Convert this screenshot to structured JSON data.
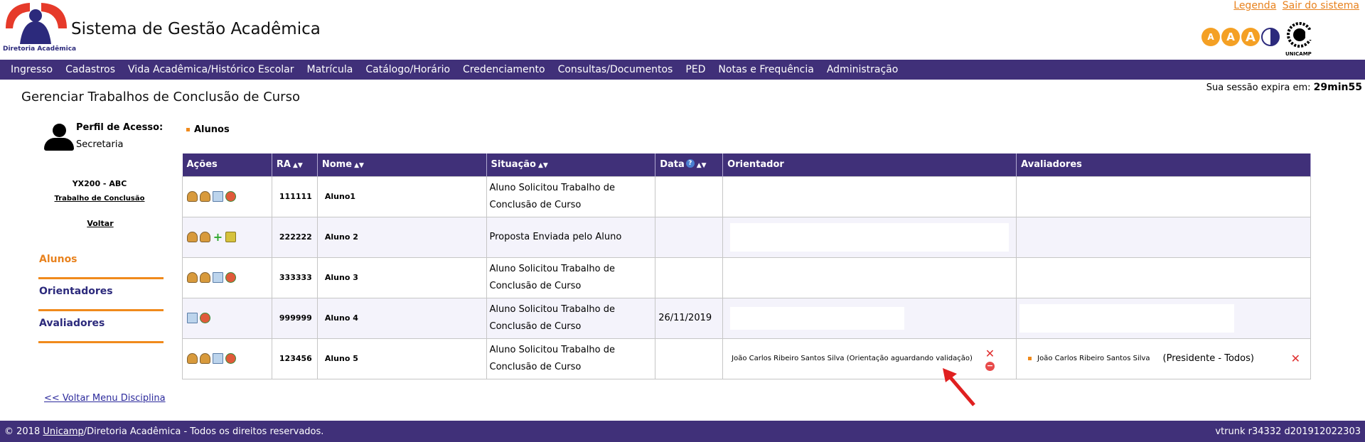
{
  "header": {
    "app_title": "Sistema de Gestão Acadêmica",
    "logo_subtitle": "Diretoria Acadêmica",
    "top_links": [
      "Legenda",
      "Sair do sistema"
    ],
    "accessibility": [
      "A",
      "A",
      "A"
    ],
    "unicamp_label": "UNICAMP"
  },
  "nav": [
    "Ingresso",
    "Cadastros",
    "Vida Acadêmica/Histórico Escolar",
    "Matrícula",
    "Catálogo/Horário",
    "Credenciamento",
    "Consultas/Documentos",
    "PED",
    "Notas e Frequência",
    "Administração"
  ],
  "page": {
    "title": "Gerenciar Trabalhos de Conclusão de Curso",
    "session_label": "Sua sessão expira em:",
    "session_value": "29min55"
  },
  "sidebar": {
    "profile_label": "Perfil de Acesso:",
    "profile_value": "Secretaria",
    "course_code": "YX200 - ABC",
    "course_link": "Trabalho de Conclusão",
    "voltar": "Voltar",
    "menu": [
      "Alunos",
      "Orientadores",
      "Avaliadores"
    ],
    "active_menu": "Alunos"
  },
  "section_title": "Alunos",
  "table": {
    "headers": [
      "Ações",
      "RA",
      "Nome",
      "Situação",
      "Data",
      "Orientador",
      "Avaliadores"
    ],
    "sort_icon": "▲▼",
    "help_icon": "?",
    "rows": [
      {
        "ra": "111111",
        "nome": "Aluno1",
        "situacao": "Aluno Solicitou Trabalho de Conclusão de Curso",
        "data": "",
        "orientador": "",
        "avaliador": "",
        "avaliador_role": ""
      },
      {
        "ra": "222222",
        "nome": "Aluno 2",
        "situacao": "Proposta Enviada pelo Aluno",
        "data": "",
        "orientador": "",
        "avaliador": "",
        "avaliador_role": ""
      },
      {
        "ra": "333333",
        "nome": "Aluno 3",
        "situacao": "Aluno Solicitou Trabalho de Conclusão de Curso",
        "data": "",
        "orientador": "",
        "avaliador": "",
        "avaliador_role": ""
      },
      {
        "ra": "999999",
        "nome": "Aluno 4",
        "situacao": "Aluno Solicitou Trabalho de Conclusão de Curso",
        "data": "26/11/2019",
        "orientador": "",
        "avaliador": "",
        "avaliador_role": ""
      },
      {
        "ra": "123456",
        "nome": "Aluno 5",
        "situacao": "Aluno Solicitou Trabalho de Conclusão de Curso",
        "data": "",
        "orientador": "João Carlos Ribeiro Santos Silva (Orientação aguardando validação)",
        "avaliador": "João Carlos Ribeiro Santos Silva",
        "avaliador_role": "(Presidente - Todos)"
      }
    ]
  },
  "back_link": "<< Voltar Menu Disciplina",
  "footer": {
    "copyright_prefix": "© 2018 ",
    "copyright_link": "Unicamp",
    "copyright_suffix": "/Diretoria Acadêmica - Todos os direitos reservados.",
    "version": "vtrunk r34332 d201912022303"
  },
  "colors": {
    "brand_purple": "#403079",
    "accent_orange": "#f08a1c",
    "link_blue": "#2c2a9c"
  }
}
